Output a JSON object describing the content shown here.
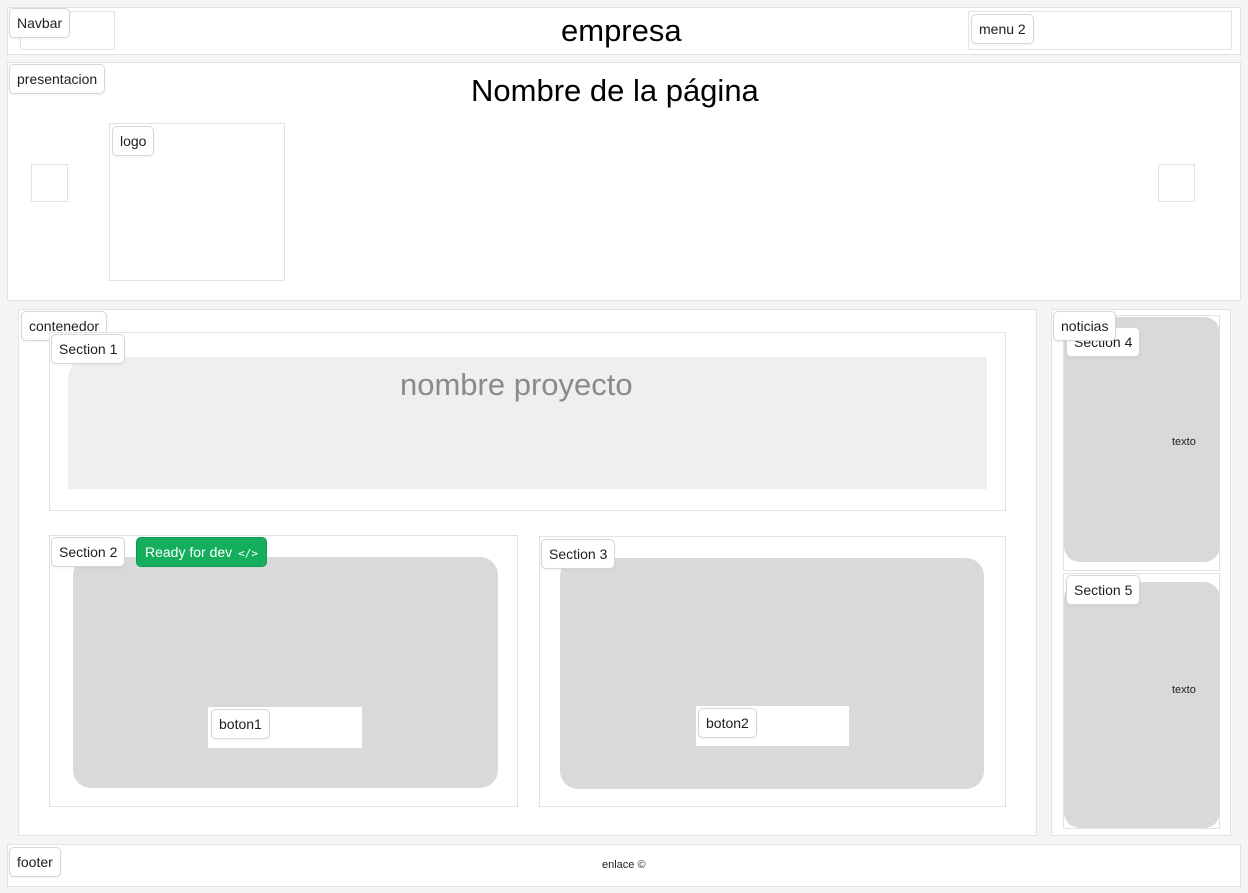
{
  "navbar": {
    "label": "Navbar",
    "company": "empresa",
    "menu2_label": "menu 2"
  },
  "presentation": {
    "label": "presentacion",
    "page_name": "Nombre de la página",
    "logo_label": "logo"
  },
  "container": {
    "label": "contenedor",
    "section1": {
      "label": "Section 1",
      "project_name": "nombre proyecto"
    },
    "section2": {
      "label": "Section 2",
      "status_badge": "Ready for dev",
      "status_icon": "</>",
      "button_label": "boton1"
    },
    "section3": {
      "label": "Section 3",
      "button_label": "boton2"
    }
  },
  "news": {
    "label": "noticias",
    "section4": {
      "label": "Section 4",
      "text": "texto"
    },
    "section5": {
      "label": "Section 5",
      "text": "texto"
    }
  },
  "footer": {
    "label": "footer",
    "link_text": "enlace ©"
  },
  "colors": {
    "ready_badge": "#14ae5c",
    "card_grey": "#d9d9d9",
    "banner_grey": "#efefef"
  }
}
